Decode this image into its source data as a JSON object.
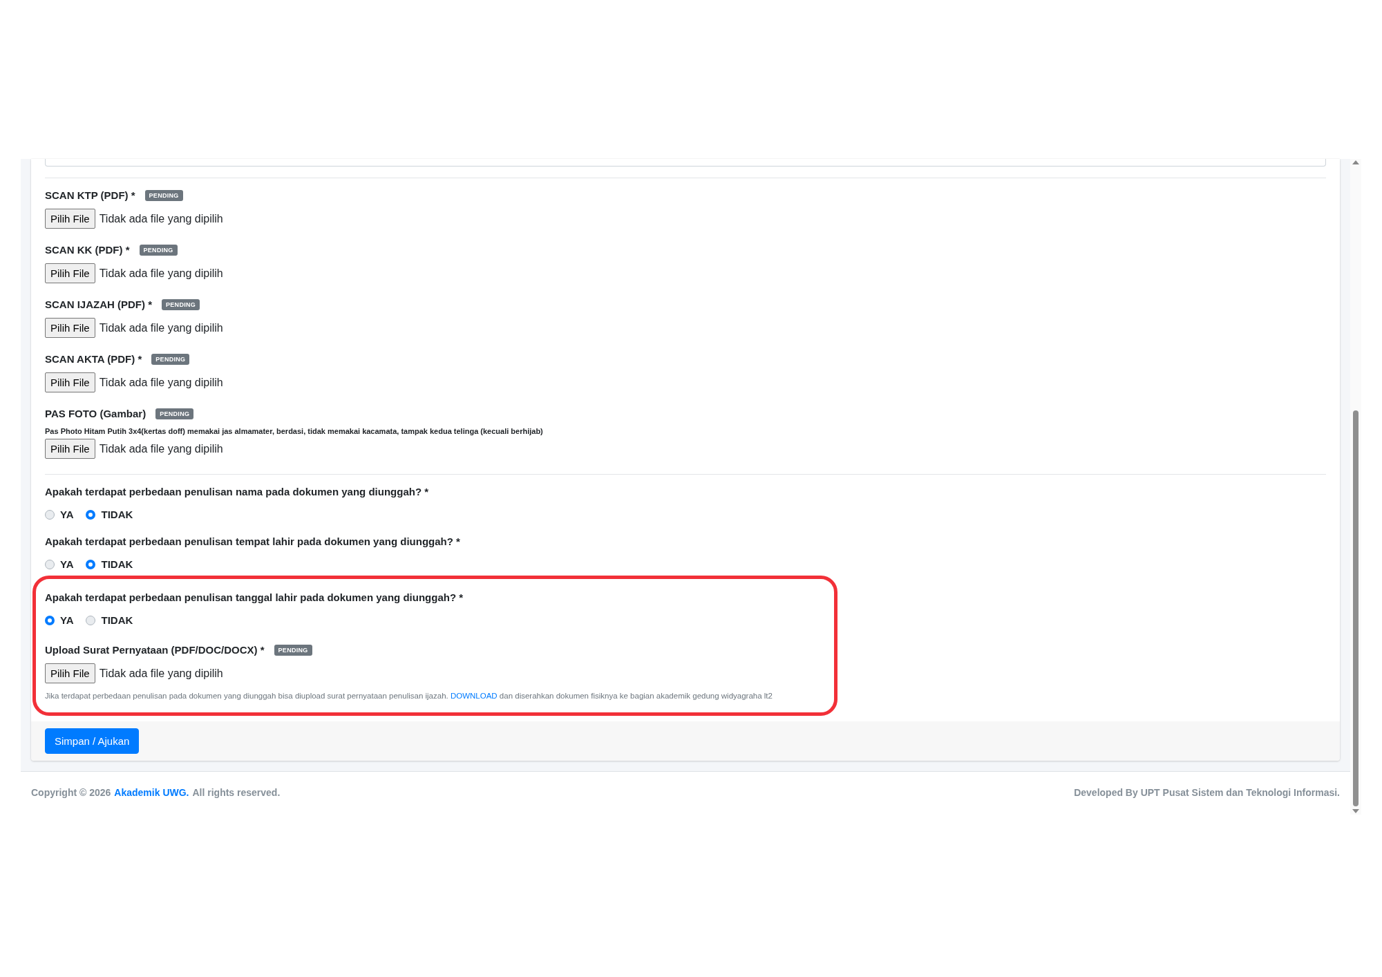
{
  "document_uploads": [
    {
      "label": "SCAN KTP (PDF) *",
      "badge": "PENDING",
      "button": "Pilih File",
      "status": "Tidak ada file yang dipilih"
    },
    {
      "label": "SCAN KK (PDF) *",
      "badge": "PENDING",
      "button": "Pilih File",
      "status": "Tidak ada file yang dipilih"
    },
    {
      "label": "SCAN IJAZAH (PDF) *",
      "badge": "PENDING",
      "button": "Pilih File",
      "status": "Tidak ada file yang dipilih"
    },
    {
      "label": "SCAN AKTA (PDF) *",
      "badge": "PENDING",
      "button": "Pilih File",
      "status": "Tidak ada file yang dipilih"
    },
    {
      "label": "PAS FOTO (Gambar)",
      "badge": "PENDING",
      "note": "Pas Photo Hitam Putih 3x4(kertas doff) memakai jas almamater, berdasi, tidak memakai kacamata, tampak kedua telinga (kecuali berhijab)",
      "button": "Pilih File",
      "status": "Tidak ada file yang dipilih"
    }
  ],
  "questions": [
    {
      "text": "Apakah terdapat perbedaan penulisan nama pada dokumen yang diunggah? *",
      "highlighted": false,
      "options": [
        {
          "label": "YA",
          "selected": false
        },
        {
          "label": "TIDAK",
          "selected": true
        }
      ]
    },
    {
      "text": "Apakah terdapat perbedaan penulisan tempat lahir pada dokumen yang diunggah? *",
      "highlighted": false,
      "options": [
        {
          "label": "YA",
          "selected": false
        },
        {
          "label": "TIDAK",
          "selected": true
        }
      ]
    },
    {
      "text": "Apakah terdapat perbedaan penulisan tanggal lahir pada dokumen yang diunggah? *",
      "highlighted": true,
      "options": [
        {
          "label": "YA",
          "selected": true
        },
        {
          "label": "TIDAK",
          "selected": false
        }
      ],
      "upload": {
        "label": "Upload Surat Pernyataan (PDF/DOC/DOCX) *",
        "badge": "PENDING",
        "button": "Pilih File",
        "status": "Tidak ada file yang dipilih",
        "hint_before": "Jika terdapat perbedaan penulisan pada dokumen yang diunggah bisa diupload surat pernyataan penulisan ijazah.",
        "hint_link": "DOWNLOAD",
        "hint_after": "dan diserahkan dokumen fisiknya ke bagian akademik gedung widyagraha lt2"
      }
    }
  ],
  "submit_button": "Simpan / Ajukan",
  "footer": {
    "copyright_before": "Copyright © 2026",
    "copyright_link": "Akademik UWG.",
    "copyright_after": "All rights reserved.",
    "credit": "Developed By UPT Pusat Sistem dan Teknologi Informasi."
  }
}
